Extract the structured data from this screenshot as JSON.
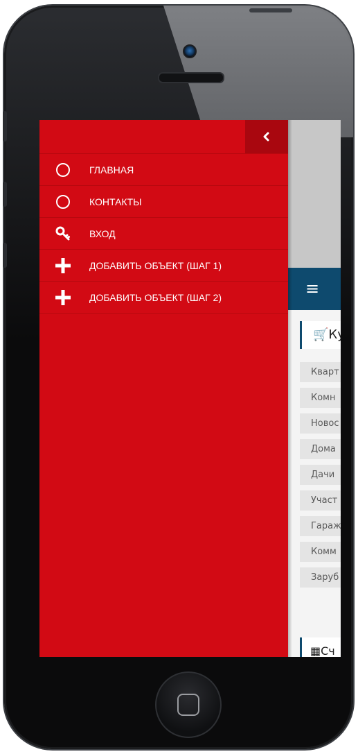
{
  "drawer": {
    "close_glyph": "‹",
    "items": [
      {
        "label": "ГЛАВНАЯ",
        "icon": "circle-outline-icon"
      },
      {
        "label": "КОНТАКТЫ",
        "icon": "circle-outline-icon"
      },
      {
        "label": "ВХОД",
        "icon": "key-icon"
      },
      {
        "label": "ДОБАВИТЬ ОБЪЕКТ (ШАГ 1)",
        "icon": "plus-icon"
      },
      {
        "label": "ДОБАВИТЬ ОБЪЕКТ (ШАГ 2)",
        "icon": "plus-icon"
      }
    ]
  },
  "background_page": {
    "section_title": "Ку",
    "categories": [
      "Кварт",
      "Комн",
      "Новос",
      "Дома",
      "Дачи",
      "Участ",
      "Гараж",
      "Комм",
      "Заруб"
    ],
    "section2_title": "Сч"
  },
  "colors": {
    "drawer_red": "#d20a14",
    "close_button": "#a9070f",
    "nav_blue": "#0e4a6e"
  }
}
